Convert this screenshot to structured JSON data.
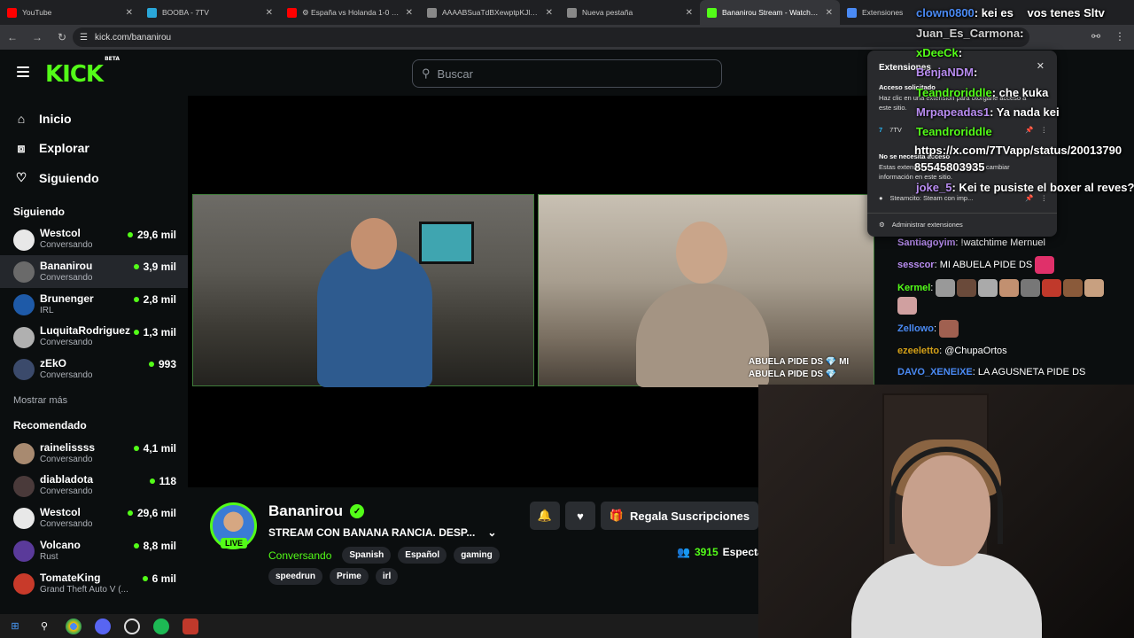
{
  "browser": {
    "tabs": [
      {
        "label": "YouTube",
        "color": "#ff0000",
        "active": false
      },
      {
        "label": "BOOBA - 7TV",
        "color": "#2aa7d9",
        "active": false
      },
      {
        "label": "⚙ España vs Holanda 1-0 FIF",
        "color": "#ff0000",
        "active": false
      },
      {
        "label": "AAAABSuaTdBXewptpKJlpCSAr",
        "color": "#888888",
        "active": false
      },
      {
        "label": "Nueva pestaña",
        "color": "#888888",
        "active": false
      },
      {
        "label": "Bananirou Stream - Watch Live",
        "color": "#53fc18",
        "active": true
      },
      {
        "label": "Extensiones",
        "color": "#4a8af4",
        "active": false
      }
    ],
    "url": "kick.com/bananirou"
  },
  "header": {
    "logo": "KICK",
    "logo_badge": "BETA",
    "search_placeholder": "Buscar"
  },
  "sidebar": {
    "nav": [
      {
        "label": "Inicio",
        "icon": "home-icon",
        "glyph": "⌂"
      },
      {
        "label": "Explorar",
        "icon": "compass-icon",
        "glyph": "⧈"
      },
      {
        "label": "Siguiendo",
        "icon": "heart-icon",
        "glyph": "♡"
      }
    ],
    "following_title": "Siguiendo",
    "following": [
      {
        "name": "Westcol",
        "sub": "Conversando",
        "viewers": "29,6 mil",
        "color": "#e8e8e8"
      },
      {
        "name": "Bananirou",
        "sub": "Conversando",
        "viewers": "3,9 mil",
        "color": "#6a6a6a"
      },
      {
        "name": "Brunenger",
        "sub": "IRL",
        "viewers": "2,8 mil",
        "color": "#1e5aa8"
      },
      {
        "name": "LuquitaRodriguez",
        "sub": "Conversando",
        "viewers": "1,3 mil",
        "color": "#b0b0b0"
      },
      {
        "name": "zEkO",
        "sub": "Conversando",
        "viewers": "993",
        "color": "#3b4a6b"
      }
    ],
    "show_more": "Mostrar más",
    "recommended_title": "Recomendado",
    "recommended": [
      {
        "name": "rainelissss",
        "sub": "Conversando",
        "viewers": "4,1 mil",
        "color": "#a88a70"
      },
      {
        "name": "diabladota",
        "sub": "Conversando",
        "viewers": "118",
        "color": "#4a3a3a"
      },
      {
        "name": "Westcol",
        "sub": "Conversando",
        "viewers": "29,6 mil",
        "color": "#e8e8e8"
      },
      {
        "name": "Volcano",
        "sub": "Rust",
        "viewers": "8,8 mil",
        "color": "#5a3a9a"
      },
      {
        "name": "TomateKing",
        "sub": "Grand Theft Auto V (...",
        "viewers": "6 mil",
        "color": "#c83a2a"
      }
    ]
  },
  "stream": {
    "overlay_line1": "ABUELA PIDE DS 💎 MI",
    "overlay_line2": "ABUELA PIDE DS 💎"
  },
  "channel": {
    "name": "Bananirou",
    "live_badge": "LIVE",
    "title": "STREAM CON BANANA RANCIA. DESP...",
    "category": "Conversando",
    "tags": [
      "Spanish",
      "Español",
      "gaming"
    ],
    "tags2": [
      "speedrun",
      "Prime",
      "irl"
    ],
    "gift_label": "Regala Suscripciones",
    "viewers": "3915",
    "viewers_label": "Especta"
  },
  "chat": {
    "messages": [
      {
        "user": "Santiagoyim",
        "color": "#b88cf0",
        "text": ": !watchtime Mernuel",
        "emotes": []
      },
      {
        "user": "sesscor",
        "color": "#b88cf0",
        "text": ": MI ABUELA PIDE DS",
        "emotes": [
          "#e0306a"
        ]
      },
      {
        "user": "Kermel",
        "color": "#53fc18",
        "text": ":",
        "emotes": [
          "#999",
          "#6a4a3a",
          "#aaa",
          "#c29070",
          "#777",
          "#c0392b",
          "#8a5a3a",
          "#c8a080",
          "#d0a0a0"
        ]
      },
      {
        "user": "Zellowo",
        "color": "#4a8af4",
        "text": ":",
        "emotes": [
          "#a06050"
        ]
      },
      {
        "user": "ezeeletto",
        "color": "#d4a017",
        "text": ": @ChupaOrtos",
        "emotes": []
      },
      {
        "user": "DAVO_XENEIXE",
        "color": "#4a8af4",
        "text": ": LA AGUSNETA PIDE DS",
        "emotes": []
      }
    ]
  },
  "extensions_popup": {
    "title": "Extensiones",
    "access_requested": "Acceso solicitado",
    "access_desc": "Haz clic en una extensión para otorgarle acceso a este sitio.",
    "ext1": "7TV",
    "no_access": "No se necesita acceso",
    "no_access_desc": "Estas extensiones no pueden ver ni cambiar información en este sitio.",
    "ext2": "Steamcito: Steam con imp...",
    "manage": "Administrar extensiones"
  },
  "chat_overlay": [
    {
      "user": "clown0800",
      "text": ": kei es",
      "extra": "vos tenes Sltv",
      "color": "#4a8af4"
    },
    {
      "user": "Juan_Es_Carmona",
      "text": ":",
      "color": "#d0d0d0"
    },
    {
      "user": "xDeeCk",
      "text": ":",
      "color": "#53fc18"
    },
    {
      "user": "BenjaNDM",
      "text": ":",
      "color": "#b88cf0"
    },
    {
      "user": "Teandroriddle",
      "text": ": che kuka",
      "color": "#53fc18"
    },
    {
      "user": "Mrpapeadas1",
      "text": ": Ya nada kei",
      "color": "#b88cf0"
    },
    {
      "user": "Teandroriddle",
      "text": "",
      "color": "#53fc18"
    },
    {
      "user": "",
      "text": "https://x.com/7TVapp/status/20013790",
      "color": "#ffffff"
    },
    {
      "user": "",
      "text": "85545803935",
      "color": "#ffffff"
    },
    {
      "user": "joke_5",
      "text": ": Kei te pusiste el boxer al reves?",
      "color": "#b88cf0"
    }
  ],
  "taskbar": {
    "apps": [
      "windows-icon",
      "search-icon",
      "chrome-icon",
      "discord-icon",
      "obs-icon",
      "spotify-icon",
      "app-icon"
    ]
  }
}
